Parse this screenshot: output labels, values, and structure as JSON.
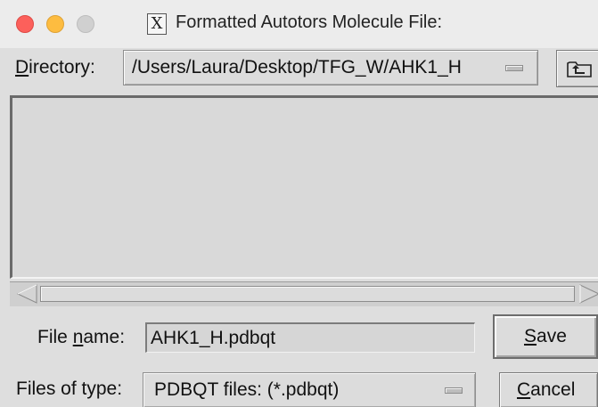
{
  "window": {
    "title": "Formatted Autotors Molecule File:",
    "title_icon": "x11-icon",
    "title_icon_glyph": "X"
  },
  "directory": {
    "label_mnemonic": "D",
    "label_rest": "irectory:",
    "value": "/Users/Laura/Desktop/TFG_W/AHK1_H"
  },
  "file_list": {
    "items": []
  },
  "file_name": {
    "label_pre": "File ",
    "label_mnemonic": "n",
    "label_post": "ame:",
    "value": "AHK1_H.pdbqt"
  },
  "save": {
    "mnemonic": "S",
    "rest": "ave"
  },
  "file_type": {
    "label": "Files of type:",
    "value": "PDBQT files: (*.pdbqt)"
  },
  "cancel": {
    "mnemonic": "C",
    "rest": "ancel"
  },
  "colors": {
    "close": "#fc605b",
    "minimize": "#fdbc40",
    "zoom_inactive": "#d0d0d0",
    "background": "#dedede"
  }
}
